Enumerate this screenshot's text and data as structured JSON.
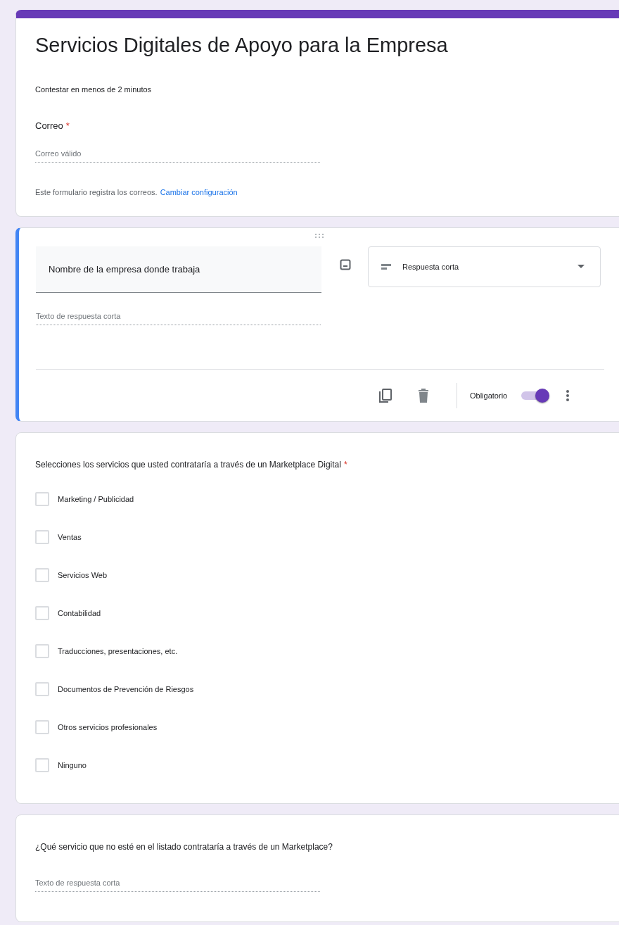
{
  "form": {
    "title": "Servicios Digitales de Apoyo para la Empresa",
    "description": "Contestar en menos de 2 minutos",
    "email": {
      "label": "Correo",
      "required_mark": "*",
      "placeholder": "Correo válido",
      "note": "Este formulario registra los correos.",
      "link": "Cambiar configuración"
    }
  },
  "questions": [
    {
      "kind": "edit",
      "title": "Nombre de la empresa donde trabaja",
      "type": "Respuesta corta",
      "placeholder": "Texto de respuesta corta",
      "required_label": "Obligatorio",
      "required": true
    },
    {
      "kind": "checkboxes",
      "title": "Selecciones los servicios que usted contrataría a través de un Marketplace Digital",
      "required_mark": "*",
      "options": [
        {
          "label": "Marketing / Publicidad",
          "checked": false
        },
        {
          "label": "Ventas",
          "checked": false
        },
        {
          "label": "Servicios Web",
          "checked": false
        },
        {
          "label": "Contabilidad",
          "checked": false
        },
        {
          "label": "Traducciones, presentaciones, etc.",
          "checked": false
        },
        {
          "label": "Documentos de Prevención de Riesgos",
          "checked": false
        },
        {
          "label": "Otros servicios profesionales",
          "checked": false
        },
        {
          "label": "Ninguno",
          "checked": false
        }
      ]
    },
    {
      "kind": "short",
      "title": "¿Qué servicio que no esté en el listado contrataría a través de un Marketplace?",
      "placeholder": "Texto de respuesta corta"
    }
  ]
}
